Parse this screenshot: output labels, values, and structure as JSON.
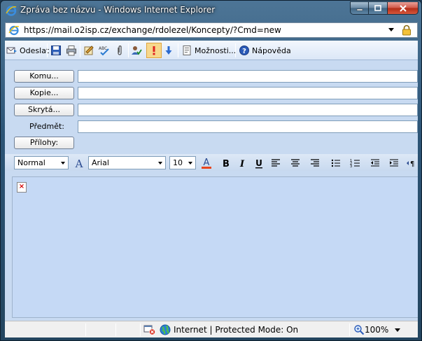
{
  "window": {
    "title": "Zpráva bez názvu - Windows Internet Explorer"
  },
  "address": {
    "url": "https://mail.o2isp.cz/exchange/rdolezel/Koncepty/?Cmd=new"
  },
  "toolbar": {
    "send_label": "Odeslat",
    "options_label": "Možnosti...",
    "help_label": "Nápověda"
  },
  "fields": {
    "to_label": "Komu...",
    "cc_label": "Kopie...",
    "bcc_label": "Skrytá...",
    "subject_label": "Předmět:",
    "attachments_label": "Přílohy:",
    "to_value": "",
    "cc_value": "",
    "bcc_value": "",
    "subject_value": ""
  },
  "format": {
    "style_value": "Normal",
    "font_value": "Arial",
    "size_value": "10"
  },
  "status": {
    "zone": "Internet | Protected Mode: On",
    "zoom": "100%"
  },
  "colors": {
    "client_bg": "#c8daf1",
    "font_color_bar": "#e8451e",
    "importance_highlight": "#f7d88c"
  }
}
